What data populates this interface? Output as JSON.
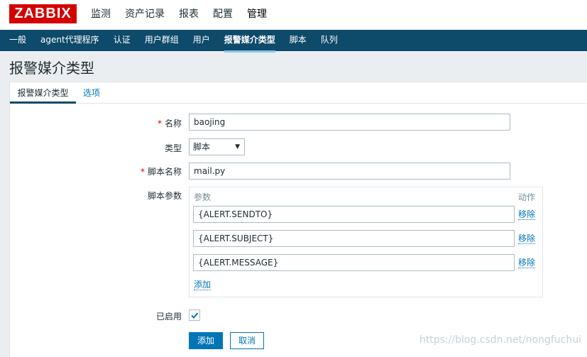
{
  "header": {
    "logo": "ZABBIX",
    "menu": [
      "监测",
      "资产记录",
      "报表",
      "配置",
      "管理"
    ],
    "active_menu_index": 4
  },
  "submenu": {
    "items": [
      "一般",
      "agent代理程序",
      "认证",
      "用户群组",
      "用户",
      "报警媒介类型",
      "脚本",
      "队列"
    ],
    "active_index": 5
  },
  "page": {
    "title": "报警媒介类型"
  },
  "tabs": [
    "报警媒介类型",
    "选项"
  ],
  "form": {
    "name_label": "名称",
    "name_value": "baojing",
    "type_label": "类型",
    "type_value": "脚本",
    "script_name_label": "脚本名称",
    "script_name_value": "mail.py",
    "script_params_label": "脚本参数",
    "params_header": "参数",
    "action_header": "动作",
    "params": [
      "{ALERT.SENDTO}",
      "{ALERT.SUBJECT}",
      "{ALERT.MESSAGE}"
    ],
    "remove_label": "移除",
    "add_link": "添加",
    "enabled_label": "已启用",
    "enabled": true,
    "required_mark": "*"
  },
  "buttons": {
    "add": "添加",
    "cancel": "取消"
  },
  "watermark": "https://blog.csdn.net/nongfuchui",
  "colors": {
    "brand": "#d40000",
    "nav": "#0e4a6a",
    "link": "#0275b8"
  }
}
